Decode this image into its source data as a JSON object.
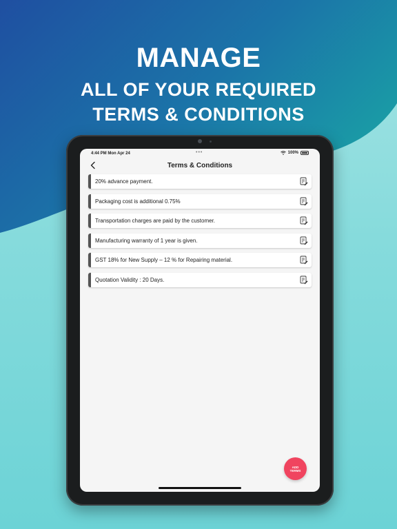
{
  "headline": {
    "line1": "MANAGE",
    "line2": "ALL OF YOUR REQUIRED",
    "line3": "TERMS & CONDITIONS"
  },
  "status_bar": {
    "time": "4:44 PM  Mon Apr 24",
    "dots": "•••",
    "battery": "100%"
  },
  "nav": {
    "title": "Terms & Conditions"
  },
  "terms": [
    "20% advance payment.",
    "Packaging cost is additional 0.75%",
    "Transportation charges are paid by the customer.",
    "Manufacturing warranty of 1 year is given.",
    "GST 18% for New Supply – 12 % for Repairing material.",
    "Quotation Validity : 20 Days."
  ],
  "fab": {
    "line1": "ADD",
    "line2": "TERMS"
  },
  "colors": {
    "fab": "#f0445f",
    "accent_bar": "#555555",
    "blob_start": "#1f4fa1",
    "blob_end": "#1aa0a6"
  },
  "icons": {
    "back": "chevron-left-icon",
    "edit": "document-edit-icon",
    "wifi": "wifi-icon",
    "battery": "battery-icon"
  }
}
